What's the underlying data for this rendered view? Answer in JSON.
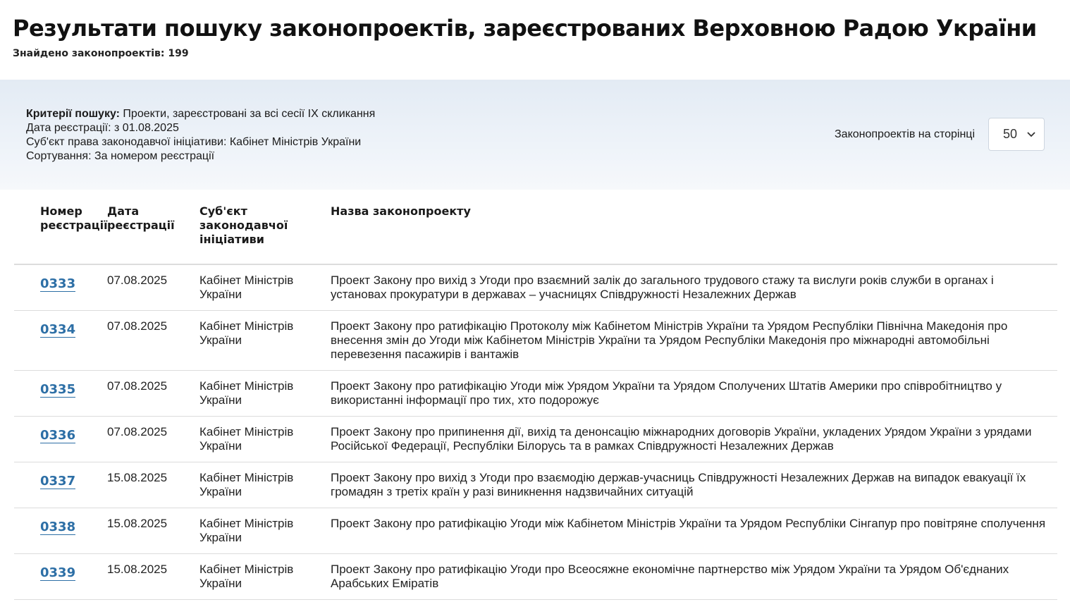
{
  "header": {
    "title": "Результати пошуку законопроектів, зареєстрованих Верховною Радою України",
    "found": "Знайдено законопроектів: 199"
  },
  "criteria": {
    "label": "Критерії пошуку:",
    "session": "Проекти, зареєстровані за всі сесії IX скликання",
    "date": "Дата реєстрації: з 01.08.2025",
    "subject": "Суб'єкт права законодавчої ініціативи: Кабінет Міністрів України",
    "sort": "Сортування: За номером реєстрації"
  },
  "per_page": {
    "label": "Законопроектів на сторінці",
    "value": "50"
  },
  "table": {
    "headers": {
      "num": "Номер реєстрації",
      "date": "Дата реєстрації",
      "subject": "Суб'єкт законодавчої ініціативи",
      "name": "Назва законопроекту"
    },
    "rows": [
      {
        "num": "0333",
        "date": "07.08.2025",
        "subject": "Кабінет Міністрів України",
        "name": "Проект Закону про вихід з Угоди про взаємний залік до загального трудового стажу та вислуги років служби в органах і установах прокуратури в державах – учасницях Співдружності Незалежних Держав"
      },
      {
        "num": "0334",
        "date": "07.08.2025",
        "subject": "Кабінет Міністрів України",
        "name": "Проект Закону про ратифікацію Протоколу між Кабінетом Міністрів України та Урядом Республіки Північна Македонія про внесення змін до Угоди між Кабінетом Міністрів України та Урядом Республіки Македонія про міжнародні автомобільні перевезення пасажирів і вантажів"
      },
      {
        "num": "0335",
        "date": "07.08.2025",
        "subject": "Кабінет Міністрів України",
        "name": "Проект Закону про ратифікацію Угоди між Урядом України та Урядом Сполучених Штатів Америки про співробітництво у використанні інформації про тих, хто подорожує"
      },
      {
        "num": "0336",
        "date": "07.08.2025",
        "subject": "Кабінет Міністрів України",
        "name": "Проект Закону про припинення дії, вихід та денонсацію міжнародних договорів України, укладених Урядом України з урядами Російської Федерації, Республіки Білорусь та в рамках Співдружності Незалежних Держав"
      },
      {
        "num": "0337",
        "date": "15.08.2025",
        "subject": "Кабінет Міністрів України",
        "name": "Проект Закону про вихід з Угоди про взаємодію держав-учасниць Співдружності Незалежних Держав на випадок евакуації їх громадян з третіх країн у разі виникнення надзвичайних ситуацій"
      },
      {
        "num": "0338",
        "date": "15.08.2025",
        "subject": "Кабінет Міністрів України",
        "name": "Проект Закону про ратифікацію Угоди між Кабінетом Міністрів України та Урядом Республіки Сінгапур про повітряне сполучення"
      },
      {
        "num": "0339",
        "date": "15.08.2025",
        "subject": "Кабінет Міністрів України",
        "name": "Проект Закону про ратифікацію Угоди про Всеосяжне економічне партнерство між Урядом України та Урядом Об'єднаних Арабських Еміратів"
      }
    ]
  }
}
